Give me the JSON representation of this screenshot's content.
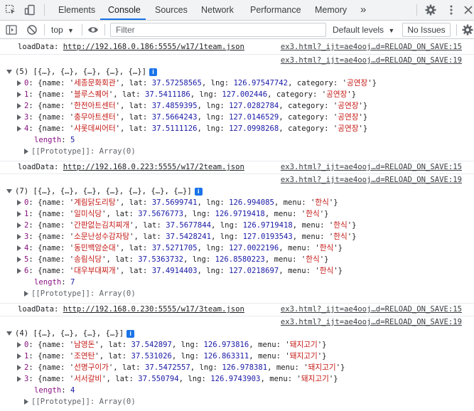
{
  "tabs": [
    "Elements",
    "Console",
    "Sources",
    "Network",
    "Performance",
    "Memory"
  ],
  "more_tabs": "»",
  "toolbar": {
    "context": "top",
    "filter_placeholder": "Filter",
    "levels": "Default levels",
    "issues": "No Issues"
  },
  "groups": [
    {
      "load_label": "loadData:",
      "url": "http://192.168.0.186:5555/w17/1team.json",
      "src1": "ex3.html?_ijt=ae4ooj…d=RELOAD_ON_SAVE:15",
      "src2": "ex3.html?_ijt=ae4ooj…d=RELOAD_ON_SAVE:19",
      "summary": "(5) [{…}, {…}, {…}, {…}, {…}]",
      "other_key": "category",
      "items": [
        {
          "idx": "0",
          "name": "세종문화회관",
          "lat": "37.57258565",
          "lng": "126.97547742",
          "other": "공연장"
        },
        {
          "idx": "1",
          "name": "블루스퀘어",
          "lat": "37.5411186",
          "lng": "127.002446",
          "other": "공연장"
        },
        {
          "idx": "2",
          "name": "한전아트센터",
          "lat": "37.4859395",
          "lng": "127.0282784",
          "other": "공연장"
        },
        {
          "idx": "3",
          "name": "충무아트센터",
          "lat": "37.5664243",
          "lng": "127.0146529",
          "other": "공연장"
        },
        {
          "idx": "4",
          "name": "샤롯데씨어터",
          "lat": "37.5111126",
          "lng": "127.0998268",
          "other": "공연장"
        }
      ],
      "length": "5",
      "proto": "[[Prototype]]: Array(0)"
    },
    {
      "load_label": "loadData:",
      "url": "http://192.168.0.223:5555/w17/2team.json",
      "src1": "ex3.html?_ijt=ae4ooj…d=RELOAD_ON_SAVE:15",
      "src2": "ex3.html?_ijt=ae4ooj…d=RELOAD_ON_SAVE:19",
      "summary": "(7) [{…}, {…}, {…}, {…}, {…}, {…}, {…}]",
      "other_key": "menu",
      "items": [
        {
          "idx": "0",
          "name": "계림닭도리탕",
          "lat": "37.5699741",
          "lng": "126.994085",
          "other": "한식"
        },
        {
          "idx": "1",
          "name": "일미식당",
          "lat": "37.5676773",
          "lng": "126.9719418",
          "other": "한식"
        },
        {
          "idx": "2",
          "name": "간판없는김치찌개",
          "lat": "37.5677844",
          "lng": "126.9719418",
          "other": "한식"
        },
        {
          "idx": "3",
          "name": "소문난성수감자탕",
          "lat": "37.5428241",
          "lng": "127.0193543",
          "other": "한식"
        },
        {
          "idx": "4",
          "name": "동민백암순대",
          "lat": "37.5271705",
          "lng": "127.0022196",
          "other": "한식"
        },
        {
          "idx": "5",
          "name": "송림식당",
          "lat": "37.5363732",
          "lng": "126.8580223",
          "other": "한식"
        },
        {
          "idx": "6",
          "name": "대우부대찌개",
          "lat": "37.4914403",
          "lng": "127.0218697",
          "other": "한식"
        }
      ],
      "length": "7",
      "proto": "[[Prototype]]: Array(0)"
    },
    {
      "load_label": "loadData:",
      "url": "http://192.168.0.230:5555/w17/3team.json",
      "src1": "ex3.html?_ijt=ae4ooj…d=RELOAD_ON_SAVE:15",
      "src2": "ex3.html?_ijt=ae4ooj…d=RELOAD_ON_SAVE:19",
      "summary": "(4) [{…}, {…}, {…}, {…}]",
      "other_key": "menu",
      "items": [
        {
          "idx": "0",
          "name": "남영돈",
          "lat": "37.542897",
          "lng": "126.973816",
          "other": "돼지고기"
        },
        {
          "idx": "1",
          "name": "조연탄",
          "lat": "37.531026",
          "lng": "126.863311",
          "other": "돼지고기"
        },
        {
          "idx": "2",
          "name": "선명구이가",
          "lat": "37.5472557",
          "lng": "126.978381",
          "other": "돼지고기"
        },
        {
          "idx": "3",
          "name": "서서갈비",
          "lat": "37.550794",
          "lng": "126.9743903",
          "other": "돼지고기"
        }
      ],
      "length": "4",
      "proto": "[[Prototype]]: Array(0)"
    }
  ]
}
